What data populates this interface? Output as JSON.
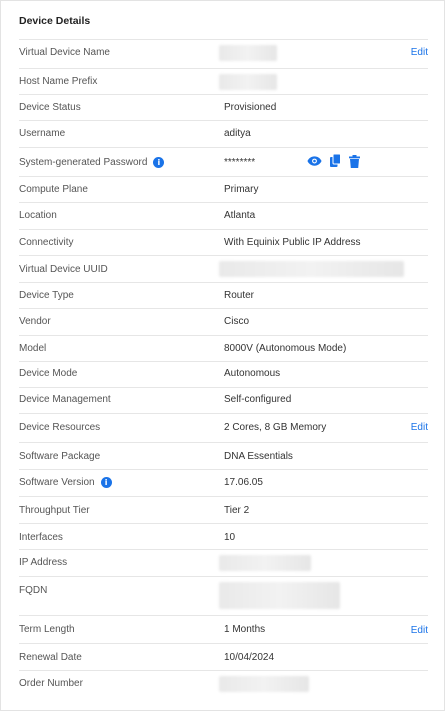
{
  "title": "Device Details",
  "edit_label": "Edit",
  "rows": {
    "virtual_device_name": {
      "label": "Virtual Device Name"
    },
    "host_name_prefix": {
      "label": "Host Name Prefix"
    },
    "device_status": {
      "label": "Device Status",
      "value": "Provisioned"
    },
    "username": {
      "label": "Username",
      "value": "aditya"
    },
    "password": {
      "label": "System-generated Password",
      "value": "********"
    },
    "compute_plane": {
      "label": "Compute Plane",
      "value": "Primary"
    },
    "location": {
      "label": "Location",
      "value": "Atlanta"
    },
    "connectivity": {
      "label": "Connectivity",
      "value": "With Equinix Public IP Address"
    },
    "uuid": {
      "label": "Virtual Device UUID"
    },
    "device_type": {
      "label": "Device Type",
      "value": "Router"
    },
    "vendor": {
      "label": "Vendor",
      "value": "Cisco"
    },
    "model": {
      "label": "Model",
      "value": "8000V (Autonomous Mode)"
    },
    "device_mode": {
      "label": "Device Mode",
      "value": "Autonomous"
    },
    "device_management": {
      "label": "Device Management",
      "value": "Self-configured"
    },
    "device_resources": {
      "label": "Device Resources",
      "value": "2 Cores, 8 GB Memory"
    },
    "software_package": {
      "label": "Software Package",
      "value": "DNA Essentials"
    },
    "software_version": {
      "label": "Software Version",
      "value": "17.06.05"
    },
    "throughput_tier": {
      "label": "Throughput Tier",
      "value": "Tier 2"
    },
    "interfaces": {
      "label": "Interfaces",
      "value": "10"
    },
    "ip_address": {
      "label": "IP Address"
    },
    "fqdn": {
      "label": "FQDN"
    },
    "term_length": {
      "label": "Term Length",
      "value": "1 Months"
    },
    "renewal_date": {
      "label": "Renewal Date",
      "value": "10/04/2024"
    },
    "order_number": {
      "label": "Order Number"
    }
  },
  "icons": {
    "info": "info-icon",
    "view": "eye-icon",
    "copy": "copy-icon",
    "delete": "trash-icon"
  },
  "colors": {
    "accent": "#1a73e8",
    "divider": "#e6e6e6",
    "label": "#555555"
  }
}
